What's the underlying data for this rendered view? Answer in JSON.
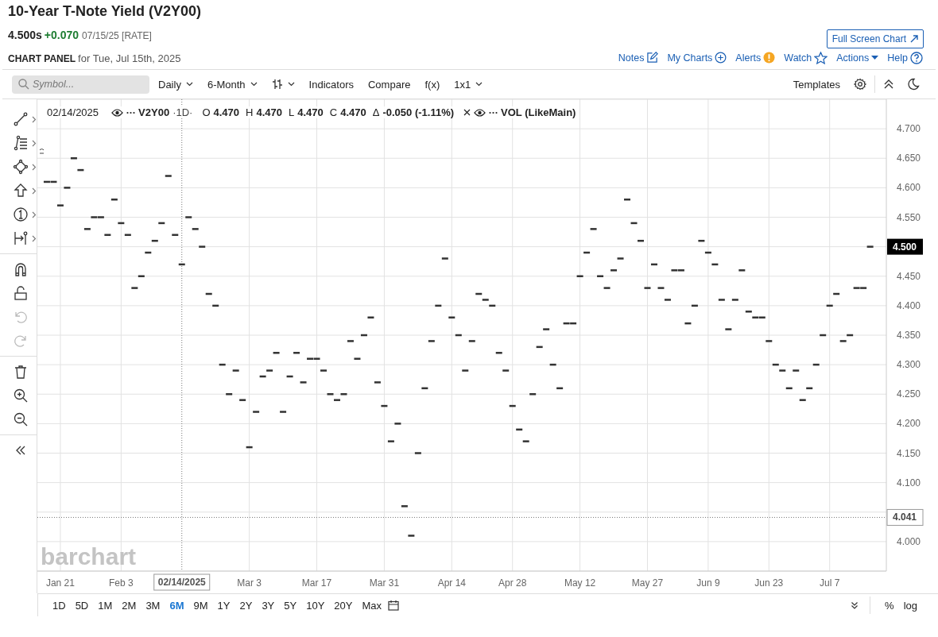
{
  "header": {
    "title": "10-Year T-Note Yield (V2Y00)",
    "price": "4.500s",
    "change": "+0.070",
    "date": "07/15/25 [RATE]",
    "full_screen": "Full Screen Chart",
    "panel_label": "CHART PANEL",
    "panel_date": "for Tue, Jul 15th, 2025"
  },
  "links": [
    {
      "label": "Notes",
      "kind": "notes"
    },
    {
      "label": "My Charts",
      "kind": "add"
    },
    {
      "label": "Alerts",
      "kind": "alert"
    },
    {
      "label": "Watch",
      "kind": "star"
    },
    {
      "label": "Actions",
      "kind": "caret"
    },
    {
      "label": "Help",
      "kind": "help"
    }
  ],
  "toolbar": {
    "placeholder": "Symbol...",
    "items": [
      {
        "kind": "menu",
        "label": "Daily"
      },
      {
        "kind": "menu",
        "label": "6-Month"
      },
      {
        "kind": "bars"
      },
      {
        "kind": "button",
        "label": "Indicators"
      },
      {
        "kind": "button",
        "label": "Compare"
      },
      {
        "kind": "button",
        "label": "f(x)"
      },
      {
        "kind": "menu",
        "label": "1x1"
      }
    ],
    "templates": "Templates"
  },
  "tool_groups": [
    [
      {
        "kind": "line",
        "disabled": false
      },
      {
        "kind": "fib",
        "disabled": false
      },
      {
        "kind": "shape",
        "disabled": false
      },
      {
        "kind": "arrow",
        "disabled": false
      },
      {
        "kind": "number",
        "disabled": false
      },
      {
        "kind": "measure",
        "disabled": false
      }
    ],
    [
      {
        "kind": "magnet",
        "disabled": false
      },
      {
        "kind": "lock",
        "disabled": false
      },
      {
        "kind": "undo",
        "disabled": true
      },
      {
        "kind": "redo",
        "disabled": true
      }
    ],
    [
      {
        "kind": "trash",
        "disabled": false
      },
      {
        "kind": "zoom-in",
        "disabled": false
      },
      {
        "kind": "zoom-out",
        "disabled": false
      }
    ],
    [
      {
        "kind": "collapse",
        "disabled": false
      }
    ]
  ],
  "legend": {
    "date": "02/14/2025",
    "interval": "·1D·",
    "ohlc": [
      {
        "label": "O",
        "value": "4.470"
      },
      {
        "label": "H",
        "value": "4.470"
      },
      {
        "label": "L",
        "value": "4.470"
      },
      {
        "label": "C",
        "value": "4.470"
      }
    ],
    "change_label": "Δ",
    "change": "-0.050 (-1.11%)",
    "study": "VOL (LikeMain)"
  },
  "chart": {
    "watermark": "barchart",
    "last_price": "4.500",
    "chart_data": {
      "type": "scatter",
      "grid": true,
      "ylim": [
        3.95,
        4.75
      ],
      "categories": [
        null,
        null,
        "Jan 21",
        null,
        null,
        null,
        null,
        null,
        null,
        null,
        null,
        "Feb 3",
        null,
        null,
        null,
        null,
        null,
        null,
        null,
        null,
        "02/14/2025",
        null,
        null,
        null,
        null,
        null,
        null,
        null,
        null,
        null,
        "Mar 3",
        null,
        null,
        null,
        null,
        null,
        null,
        null,
        null,
        null,
        "Mar 17",
        null,
        null,
        null,
        null,
        null,
        null,
        null,
        null,
        null,
        "Mar 31",
        null,
        null,
        null,
        null,
        null,
        null,
        null,
        null,
        null,
        "Apr 14",
        null,
        null,
        null,
        null,
        null,
        null,
        null,
        null,
        "Apr 28",
        null,
        null,
        null,
        null,
        null,
        null,
        null,
        null,
        null,
        "May 12",
        null,
        null,
        null,
        null,
        null,
        null,
        null,
        null,
        null,
        "May 27",
        null,
        null,
        null,
        null,
        null,
        null,
        null,
        null,
        "Jun 9",
        null,
        null,
        null,
        null,
        null,
        null,
        null,
        null,
        "Jun 23",
        null,
        null,
        null,
        null,
        null,
        null,
        null,
        null,
        "Jul 7",
        null,
        null,
        null,
        null,
        null,
        null
      ],
      "yticks": [
        {
          "value": 4.0,
          "label": "4.000"
        },
        {
          "value": 4.1,
          "label": "4.100"
        },
        {
          "value": 4.15,
          "label": "4.150"
        },
        {
          "value": 4.2,
          "label": "4.200"
        },
        {
          "value": 4.25,
          "label": "4.250"
        },
        {
          "value": 4.3,
          "label": "4.300"
        },
        {
          "value": 4.35,
          "label": "4.350"
        },
        {
          "value": 4.4,
          "label": "4.400"
        },
        {
          "value": 4.45,
          "label": "4.450"
        },
        {
          "value": 4.55,
          "label": "4.550"
        },
        {
          "value": 4.6,
          "label": "4.600"
        },
        {
          "value": 4.65,
          "label": "4.650"
        },
        {
          "value": 4.7,
          "label": "4.700"
        }
      ],
      "series": [
        {
          "name": "V2Y00",
          "color": "#333333",
          "values": [
            4.61,
            4.61,
            4.57,
            4.6,
            4.65,
            4.63,
            4.53,
            4.55,
            4.55,
            4.52,
            4.58,
            4.54,
            4.52,
            4.43,
            4.45,
            4.49,
            4.51,
            4.54,
            4.62,
            4.52,
            4.47,
            4.55,
            4.53,
            4.5,
            4.42,
            4.4,
            4.3,
            4.25,
            4.29,
            4.24,
            4.16,
            4.22,
            4.28,
            4.29,
            4.32,
            4.22,
            4.28,
            4.32,
            4.27,
            4.31,
            4.31,
            4.29,
            4.25,
            4.24,
            4.25,
            4.34,
            4.31,
            4.35,
            4.38,
            4.27,
            4.23,
            4.17,
            4.2,
            4.06,
            4.01,
            4.15,
            4.26,
            4.34,
            4.4,
            4.48,
            4.38,
            4.35,
            4.29,
            4.34,
            4.42,
            4.41,
            4.4,
            4.32,
            4.29,
            4.23,
            4.19,
            4.17,
            4.25,
            4.33,
            4.36,
            4.3,
            4.26,
            4.37,
            4.37,
            4.45,
            4.49,
            4.53,
            4.45,
            4.43,
            4.46,
            4.48,
            4.58,
            4.54,
            4.51,
            4.43,
            4.47,
            4.43,
            4.41,
            4.46,
            4.46,
            4.37,
            4.4,
            4.51,
            4.49,
            4.47,
            4.41,
            4.36,
            4.41,
            4.46,
            4.39,
            4.38,
            4.38,
            4.34,
            4.3,
            4.29,
            4.26,
            4.29,
            4.24,
            4.26,
            4.3,
            4.35,
            4.4,
            4.42,
            4.34,
            4.35,
            4.43,
            4.43,
            4.5
          ]
        }
      ],
      "ref_lines": [
        {
          "axis": "x",
          "value": "02/14/2025"
        },
        {
          "axis": "y",
          "value": 4.041,
          "label": "4.041"
        }
      ]
    }
  },
  "ranges": [
    {
      "label": "1D",
      "selected": false
    },
    {
      "label": "5D",
      "selected": false
    },
    {
      "label": "1M",
      "selected": false
    },
    {
      "label": "2M",
      "selected": false
    },
    {
      "label": "3M",
      "selected": false
    },
    {
      "label": "6M",
      "selected": true
    },
    {
      "label": "9M",
      "selected": false
    },
    {
      "label": "1Y",
      "selected": false
    },
    {
      "label": "2Y",
      "selected": false
    },
    {
      "label": "3Y",
      "selected": false
    },
    {
      "label": "5Y",
      "selected": false
    },
    {
      "label": "10Y",
      "selected": false
    },
    {
      "label": "20Y",
      "selected": false
    },
    {
      "label": "Max",
      "selected": false
    }
  ],
  "scale_buttons": [
    "%",
    "log"
  ]
}
